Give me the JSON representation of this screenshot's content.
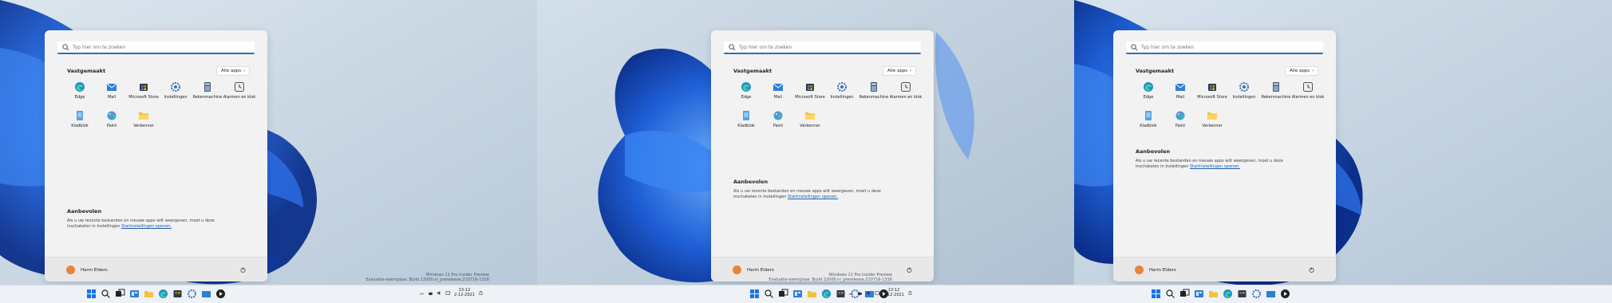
{
  "screens": [
    {
      "search_placeholder": "Typ hier om te zoeken",
      "pinned_title": "Vastgemaakt",
      "all_apps_label": "Alle apps",
      "apps": [
        "Edge",
        "Mail",
        "Microsoft Store",
        "Instellingen",
        "Rekenmachine",
        "Alarmen en klok",
        "Kladblok",
        "Paint",
        "Verkenner"
      ],
      "recommended_title": "Aanbevolen",
      "recommended_text": "Als u uw recente bestanden en nieuwe apps wilt weergeven, moet u deze inschakelen in",
      "recommended_link_pre": "Instellingen",
      "recommended_link": "Startinstellingen openen.",
      "user_name": "Harm Elders",
      "watermark_line1": "Windows 11 Pro Insider Preview",
      "watermark_line2": "Evaluatie-exemplaar. Build 22000.ni_prerelease.210716-1316",
      "clock_time": "13:12",
      "clock_date": "2-12-2021"
    },
    {
      "search_placeholder": "Typ hier om te zoeken",
      "pinned_title": "Vastgemaakt",
      "all_apps_label": "Alle apps",
      "apps": [
        "Edge",
        "Mail",
        "Microsoft Store",
        "Instellingen",
        "Rekenmachine",
        "Alarmen en klok",
        "Kladblok",
        "Paint",
        "Verkenner"
      ],
      "recommended_title": "Aanbevolen",
      "recommended_text": "Als u uw recente bestanden en nieuwe apps wilt weergeven, moet u deze inschakelen in",
      "recommended_link_pre": "Instellingen",
      "recommended_link": "Startinstellingen openen.",
      "user_name": "Harm Elders",
      "watermark_line1": "Windows 11 Pro Insider Preview",
      "watermark_line2": "Evaluatie-exemplaar. Build 22000.ni_prerelease.210716-1316",
      "clock_time": "13:12",
      "clock_date": "2-12-2021"
    },
    {
      "search_placeholder": "Typ hier om te zoeken",
      "pinned_title": "Vastgemaakt",
      "all_apps_label": "Alle apps",
      "apps": [
        "Edge",
        "Mail",
        "Microsoft Store",
        "Instellingen",
        "Rekenmachine",
        "Alarmen en klok",
        "Kladblok",
        "Paint",
        "Verkenner"
      ],
      "recommended_title": "Aanbevolen",
      "recommended_text": "Als u uw recente bestanden en nieuwe apps wilt weergeven, moet u deze inschakelen in",
      "recommended_link_pre": "Instellingen",
      "recommended_link": "Startinstellingen openen.",
      "user_name": "Harm Elders"
    }
  ],
  "colors": {
    "accent": "#2b6fb0",
    "wallpaper": "#c9d6e3",
    "bloom": "#1f5fd6"
  },
  "icons": [
    "search-icon",
    "edge-icon",
    "mail-icon",
    "store-icon",
    "settings-icon",
    "calculator-icon",
    "clock-icon",
    "notepad-icon",
    "paint-icon",
    "explorer-icon",
    "windows-icon",
    "taskview-icon",
    "widgets-icon",
    "power-icon"
  ]
}
